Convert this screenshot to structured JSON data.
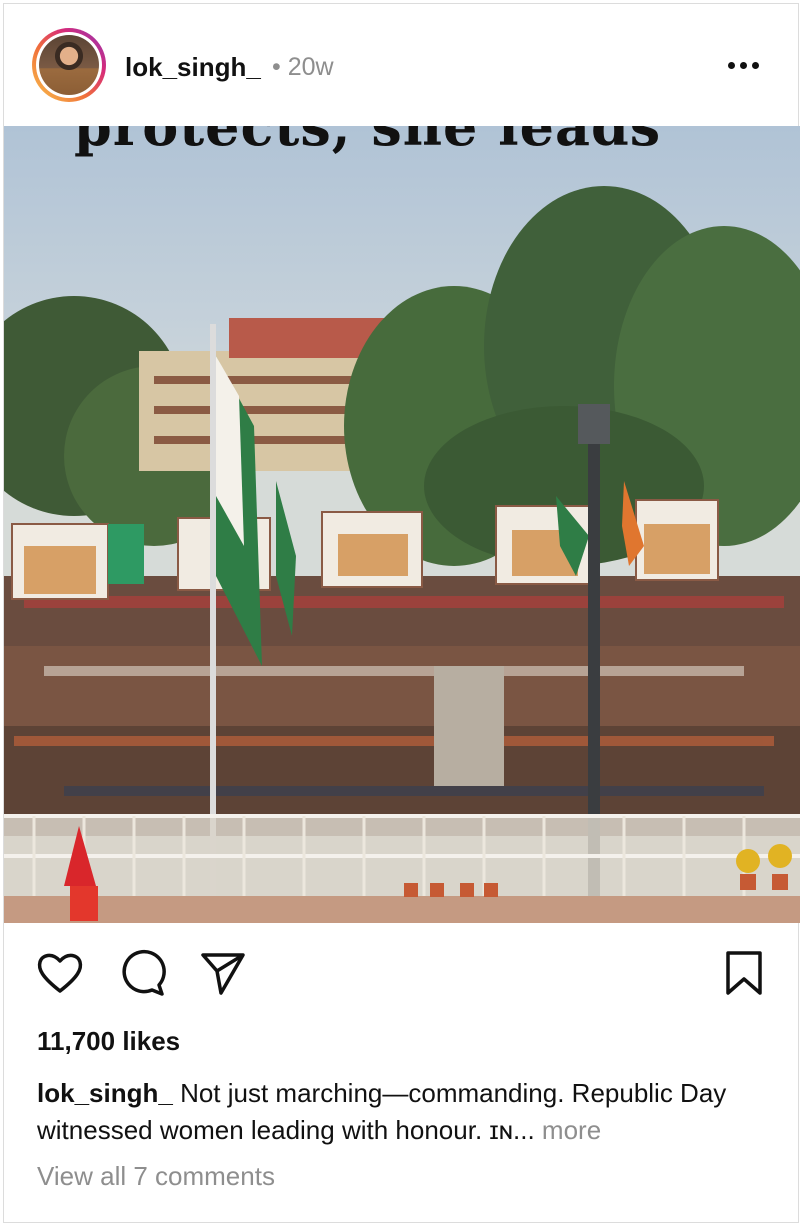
{
  "post": {
    "username": "lok_singh_",
    "time": "• 20w",
    "overlay_text": "protects, she leads",
    "likes": "11,700 likes",
    "caption_user": "lok_singh_",
    "caption_text": "Not just marching—commanding. Republic Day witnessed women leading with honour. ɪɴ...",
    "more_label": "more",
    "view_comments": "View all 7 comments"
  },
  "icons": {
    "like": "heart-icon",
    "comment": "comment-icon",
    "share": "send-icon",
    "save": "bookmark-icon",
    "options": "more-options-icon"
  }
}
